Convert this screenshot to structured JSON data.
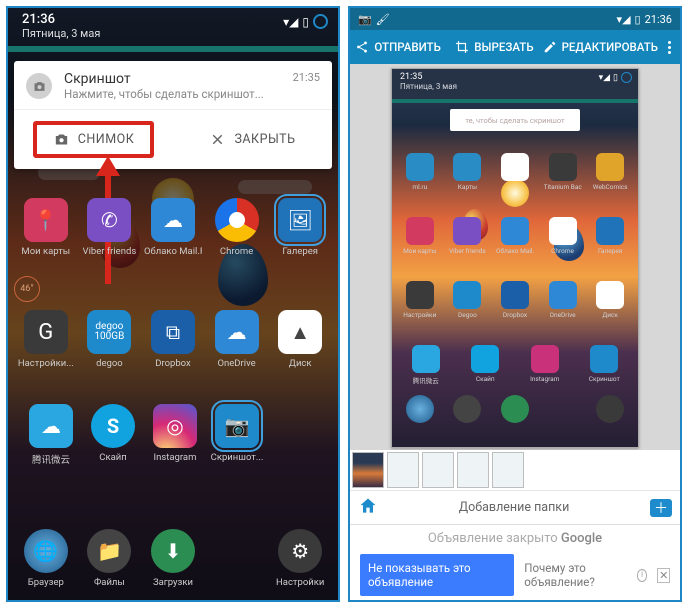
{
  "left": {
    "status": {
      "time": "21:36",
      "date": "Пятница, 3 мая",
      "battery": "▮",
      "signal": "▾◢"
    },
    "notification": {
      "title": "Скриншот",
      "subtitle": "Нажмите, чтобы сделать скриншот...",
      "time": "21:35",
      "action_snap": "СНИМОК",
      "action_close": "ЗАКРЫТЬ"
    },
    "temp": "46°",
    "apps_row1": [
      {
        "label": "Мои карты",
        "color": "#d23b5f"
      },
      {
        "label": "Viber friends",
        "color": "#7a4fc4"
      },
      {
        "label": "Облако Mail.Ru",
        "color": "#2f88d6"
      },
      {
        "label": "Chrome",
        "color": "#ffffff"
      },
      {
        "label": "Галерея",
        "color": "#2073b8"
      }
    ],
    "apps_row2": [
      {
        "label": "Настройки...",
        "color": "#3a3a3a"
      },
      {
        "label": "degoo",
        "color": "#1e8acc"
      },
      {
        "label": "Dropbox",
        "color": "#1a5fa8"
      },
      {
        "label": "OneDrive",
        "color": "#2f88d6"
      },
      {
        "label": "Диск",
        "color": "#ffffff"
      }
    ],
    "apps_row3": [
      {
        "label": "腾讯微云",
        "color": "#2aa7e0"
      },
      {
        "label": "Скайп",
        "color": "#11a3e0"
      },
      {
        "label": "Instagram",
        "color": "#c9317a"
      },
      {
        "label": "Скриншот...",
        "color": "#1e8acc"
      }
    ],
    "dock": [
      {
        "label": "Браузер",
        "color": "#2e6aa3"
      },
      {
        "label": "Файлы",
        "color": "#444"
      },
      {
        "label": "Загрузки",
        "color": "#2c8d52"
      },
      {
        "label": "",
        "color": "transparent"
      },
      {
        "label": "Настройки",
        "color": "#3a3a3a"
      }
    ]
  },
  "right": {
    "status": {
      "time": "21:36"
    },
    "toolbar": {
      "send": "ОТПРАВИТЬ",
      "crop": "ВЫРЕЗАТЬ",
      "edit": "РЕДАКТИРОВАТЬ"
    },
    "preview": {
      "time": "21:35",
      "date": "Пятница, 3 мая",
      "hint": "те, чтобы сделать скриншот",
      "rows": [
        [
          "ml.ru",
          "Карты",
          "",
          "Titanium Backup",
          "WebComics"
        ],
        [
          "Мои карты",
          "Viber friends",
          "Облако Mail.Ru",
          "Chrome",
          "Галерея"
        ],
        [
          "Настройки",
          "Degoo",
          "Dropbox",
          "OneDrive",
          "Диск"
        ],
        [
          "腾讯微云",
          "Скайп",
          "Instagram",
          "Скриншот"
        ]
      ],
      "colors": [
        [
          "#2a8cc4",
          "#2a8cc4",
          "#ffffff",
          "#3a3a3a",
          "#e0a42a"
        ],
        [
          "#d23b5f",
          "#7a4fc4",
          "#2f88d6",
          "#ffffff",
          "#2073b8"
        ],
        [
          "#3a3a3a",
          "#1e8acc",
          "#1a5fa8",
          "#2f88d6",
          "#ffffff"
        ],
        [
          "#2aa7e0",
          "#11a3e0",
          "#c9317a",
          "#1e8acc"
        ]
      ]
    },
    "folder_bar": "Добавление папки",
    "ad": {
      "headline_pre": "Объявление закрыто ",
      "headline_brand": "Google",
      "primary": "Не показывать это объявление",
      "secondary": "Почему это объявление?"
    }
  }
}
